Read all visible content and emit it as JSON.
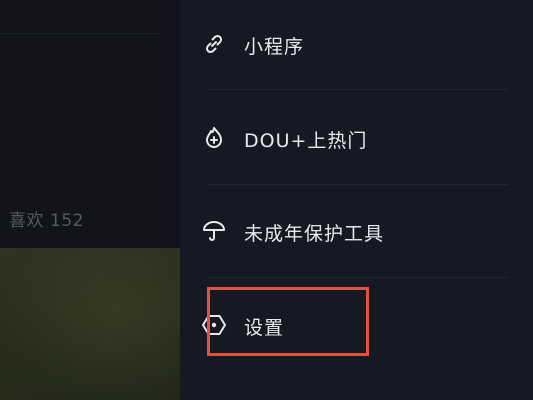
{
  "background": {
    "likes_label": "喜欢",
    "likes_count": "152"
  },
  "menu": {
    "items": [
      {
        "label": "小程序",
        "icon": "link-icon"
      },
      {
        "label": "DOU+上热门",
        "icon": "flame-plus-icon"
      },
      {
        "label": "未成年保护工具",
        "icon": "umbrella-icon"
      },
      {
        "label": "设置",
        "icon": "hexagon-settings-icon"
      }
    ]
  },
  "colors": {
    "background": "#161823",
    "text": "#e8e9ec",
    "highlight": "#e0553a"
  }
}
